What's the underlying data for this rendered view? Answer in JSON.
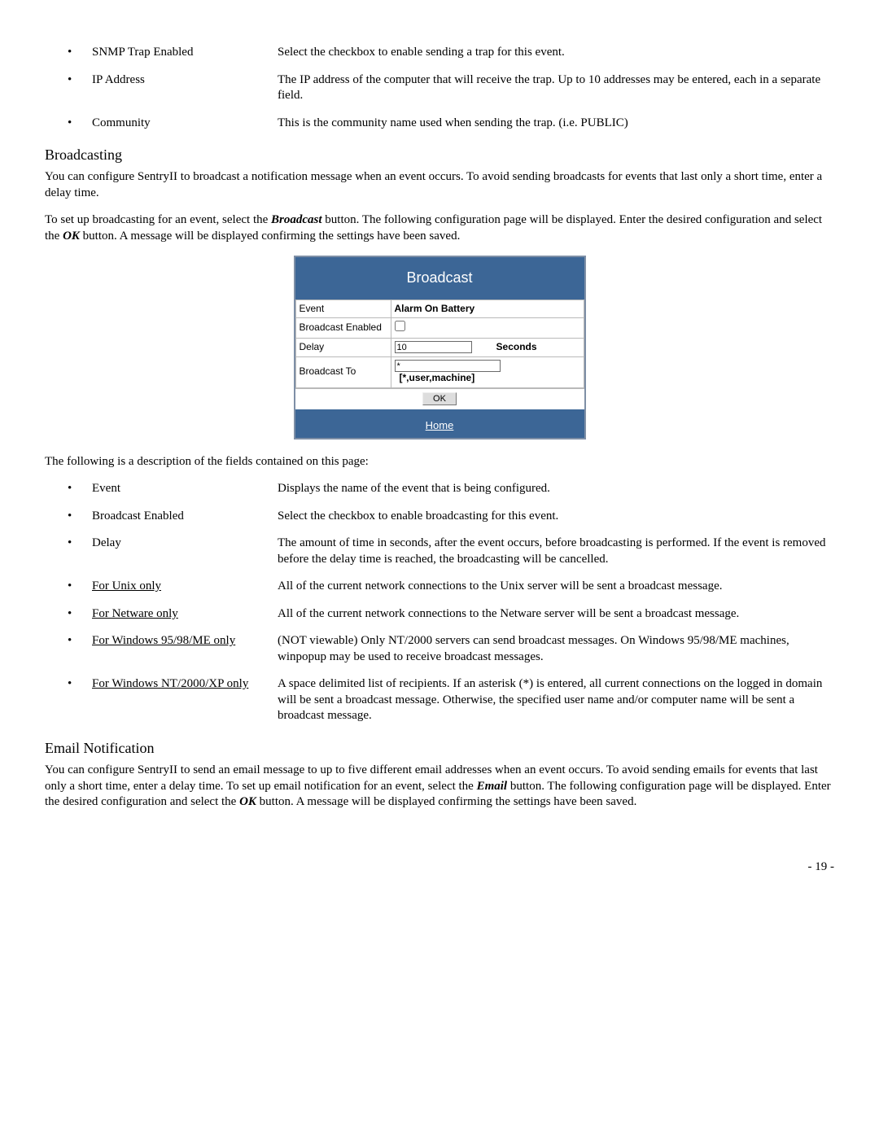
{
  "top_bullets": [
    {
      "term": "SNMP Trap Enabled",
      "desc": "Select the checkbox to enable sending a trap for this event."
    },
    {
      "term": "IP Address",
      "desc": "The IP address of the computer that will receive the trap.  Up to 10 addresses may be entered, each in a separate field."
    },
    {
      "term": "Community",
      "desc": "This is the community name used when sending the trap.  (i.e. PUBLIC)"
    }
  ],
  "broadcasting": {
    "heading": "Broadcasting",
    "para1": "You can configure SentryII to broadcast a notification message when an event occurs. To avoid sending broadcasts for events that last only a short time, enter a delay time.",
    "para2_pre": "To set up broadcasting for an event, select the ",
    "para2_bold1": "Broadcast",
    "para2_mid": " button. The following configuration page will be displayed. Enter the desired configuration and select the ",
    "para2_bold2": "OK",
    "para2_post": " button.   A message will be displayed confirming the settings have been saved."
  },
  "panel": {
    "title": "Broadcast",
    "rows": {
      "event_label": "Event",
      "event_value": "Alarm On Battery",
      "enabled_label": "Broadcast Enabled",
      "delay_label": "Delay",
      "delay_value": "10",
      "delay_unit": "Seconds",
      "to_label": "Broadcast To",
      "to_value": "*",
      "to_hint": "[*,user,machine]"
    },
    "ok": "OK",
    "home": "Home"
  },
  "fields_intro": "The following is a description of the fields contained on this page:",
  "field_bullets": [
    {
      "term": "Event",
      "underline": false,
      "desc": "Displays the name of the event that is being configured."
    },
    {
      "term": "Broadcast Enabled",
      "underline": false,
      "desc": "Select the checkbox to enable broadcasting for this event."
    },
    {
      "term": "Delay",
      "underline": false,
      "desc": "The amount of time in seconds, after the event occurs, before broadcasting is performed.  If the event is removed before the delay time is reached, the broadcasting will be cancelled."
    },
    {
      "term": "For Unix only",
      "underline": true,
      "desc": "All of the current network connections to the Unix server will be sent a broadcast message."
    },
    {
      "term": "For Netware only",
      "underline": true,
      "desc": "All of the current network connections to the Netware server will be sent a broadcast message."
    },
    {
      "term": "For Windows 95/98/ME only",
      "underline": true,
      "desc": "(NOT viewable) Only NT/2000 servers can send broadcast messages. On Windows 95/98/ME machines, winpopup may be used to receive broadcast messages."
    },
    {
      "term": "For Windows NT/2000/XP only",
      "underline": true,
      "desc": "A space delimited list of recipients.  If an asterisk (*) is entered, all current connections on the logged in domain will be sent a broadcast message.  Otherwise, the specified user name and/or computer name will be sent a broadcast message."
    }
  ],
  "email": {
    "heading": "Email Notification",
    "para_pre": "You can configure SentryII to send an email message to up to five different email addresses when an event occurs. To avoid sending emails for events that last only a short time, enter a delay time. To set up email notification for an event, select the ",
    "para_bold1": "Email",
    "para_mid": " button.  The following configuration page will be displayed. Enter the desired configuration and select the ",
    "para_bold2": "OK",
    "para_post": " button.   A message will be displayed confirming the settings have been saved."
  },
  "page_number": "-  19  -"
}
